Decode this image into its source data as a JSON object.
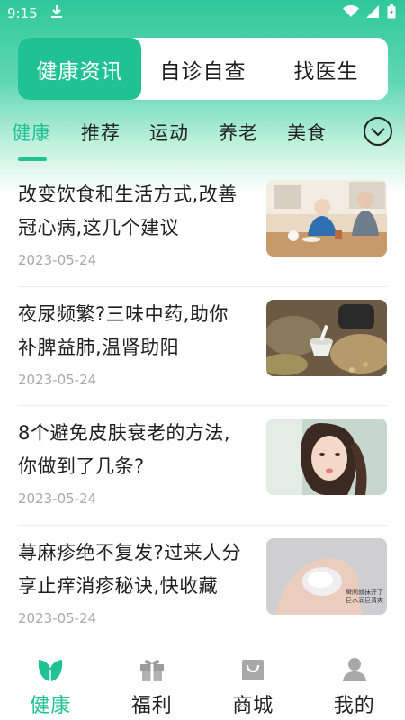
{
  "status_bar": {
    "time": "9:15",
    "icons": [
      "download-icon",
      "wifi-icon",
      "signal-icon",
      "battery-icon"
    ]
  },
  "top_tabs": [
    {
      "label": "健康资讯",
      "active": true
    },
    {
      "label": "自诊自查",
      "active": false
    },
    {
      "label": "找医生",
      "active": false
    }
  ],
  "categories": [
    {
      "label": "健康",
      "active": true
    },
    {
      "label": "推荐",
      "active": false
    },
    {
      "label": "运动",
      "active": false
    },
    {
      "label": "养老",
      "active": false
    },
    {
      "label": "美食",
      "active": false
    }
  ],
  "news": [
    {
      "title": "改变饮食和生活方式,改善冠心病,这几个建议",
      "date": "2023-05-24",
      "thumb": "elderly-couple-dining-photo"
    },
    {
      "title": "夜尿频繁?三味中药,助你补脾益肺,温肾助阳",
      "date": "2023-05-24",
      "thumb": "herbal-medicine-photo"
    },
    {
      "title": "8个避免皮肤衰老的方法,你做到了几条?",
      "date": "2023-05-24",
      "thumb": "young-woman-portrait-photo"
    },
    {
      "title": "荨麻疹绝不复发?过来人分享止痒消疹秘诀,快收藏",
      "date": "2023-05-24",
      "thumb": "hand-with-gel-photo",
      "thumb_caption": [
        "瞬间就抹开了",
        "巨水润巨清爽"
      ]
    }
  ],
  "bottom_nav": [
    {
      "label": "健康",
      "icon": "leaf-icon",
      "active": true
    },
    {
      "label": "福利",
      "icon": "gift-icon",
      "active": false
    },
    {
      "label": "商城",
      "icon": "shop-bag-icon",
      "active": false
    },
    {
      "label": "我的",
      "icon": "person-icon",
      "active": false
    }
  ],
  "colors": {
    "accent": "#20c193",
    "text": "#1f1f1f",
    "muted": "#a8a8a8"
  }
}
